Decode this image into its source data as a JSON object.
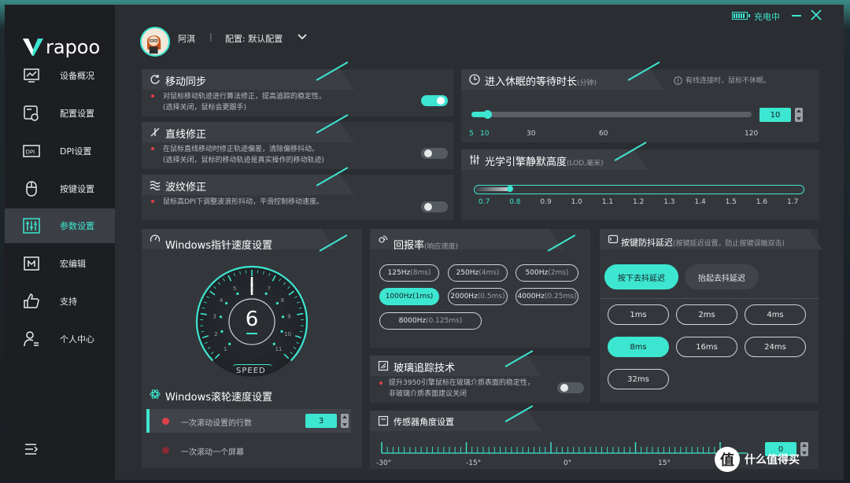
{
  "brand": {
    "logo_text": "rapoo"
  },
  "window": {
    "charging_text": "充电中"
  },
  "header": {
    "user_name": "阿淇",
    "separator": "|",
    "profile_label": "配置: 默认配置"
  },
  "sidebar": {
    "items": [
      {
        "label": "设备概况",
        "icon": "monitor-icon"
      },
      {
        "label": "配置设置",
        "icon": "config-icon"
      },
      {
        "label": "DPI设置",
        "icon": "dpi-icon"
      },
      {
        "label": "按键设置",
        "icon": "mouse-icon"
      },
      {
        "label": "参数设置",
        "icon": "sliders-icon",
        "active": true
      },
      {
        "label": "宏编辑",
        "icon": "macro-icon"
      },
      {
        "label": "支持",
        "icon": "thumbs-up-icon"
      },
      {
        "label": "个人中心",
        "icon": "user-icon"
      }
    ]
  },
  "motion_sync": {
    "title": "移动同步",
    "desc1": "对鼠标移动轨迹进行算法修正，提高追踪的稳定性。",
    "desc2": "(选择关闭，鼠标会更跟手)",
    "enabled": true
  },
  "angle_snap": {
    "title": "直线修正",
    "desc1": "在鼠标直线移动时修正轨迹偏差，清除偏移抖动。",
    "desc2": "(选择关闭，鼠标的移动轨迹是真实操作的移动轨迹)",
    "enabled": false
  },
  "ripple": {
    "title": "波纹修正",
    "desc1": "鼠标高DPI下调整波浪形抖动，平滑控制移动速度。",
    "enabled": false
  },
  "sleep": {
    "title": "进入休眠的等待时长",
    "unit": "(分钟)",
    "note": "有线连接时，鼠标不休眠。",
    "value": "10",
    "min": 5,
    "max": 120,
    "ticks": [
      "5",
      "10",
      "30",
      "60",
      "120"
    ]
  },
  "lod": {
    "title": "光学引擎静默高度",
    "unit": "(LOD,毫米)",
    "value": 0.8,
    "min": 0.7,
    "max": 1.7,
    "ticks": [
      "0.7",
      "0.8",
      "0.9",
      "1.0",
      "1.1",
      "1.2",
      "1.3",
      "1.4",
      "1.5",
      "1.6",
      "1.7"
    ]
  },
  "pointer_speed": {
    "title": "Windows指针速度设置",
    "value": "6",
    "speed_label": "SPEED",
    "dial_numbers": [
      "1",
      "2",
      "3",
      "4",
      "5",
      "6",
      "7",
      "8",
      "9",
      "10",
      "11"
    ]
  },
  "scroll": {
    "title": "Windows滚轮速度设置",
    "row1_label": "一次滚动设置的行数",
    "row1_value": "3",
    "row2_label": "一次滚动一个屏幕"
  },
  "polling": {
    "title": "回报率",
    "unit": "(响应速度)",
    "options": [
      {
        "main": "125Hz",
        "sub": "(8ms)"
      },
      {
        "main": "250Hz",
        "sub": "(4ms)"
      },
      {
        "main": "500Hz",
        "sub": "(2ms)"
      },
      {
        "main": "1000Hz",
        "sub": "(1ms)",
        "selected": true
      },
      {
        "main": "2000Hz",
        "sub": "(0.5ms)"
      },
      {
        "main": "4000Hz",
        "sub": "(0.25ms)"
      },
      {
        "main": "8000Hz",
        "sub": "(0.125ms)"
      }
    ]
  },
  "glass": {
    "title": "玻璃追踪技术",
    "desc1": "提升3950引擎鼠标在玻璃介质表面的稳定性，",
    "desc2": "非玻璃介质表面建议关闭",
    "enabled": false
  },
  "sensor_angle": {
    "title": "传感器角度设置",
    "value": "0",
    "ticks": [
      "-30°",
      "-15°",
      "0°",
      "15°"
    ]
  },
  "debounce": {
    "title": "按键防抖延迟",
    "subtitle": "(按键延迟设置，防止按键误触双击)",
    "tabs": [
      {
        "label": "按下去抖延迟",
        "selected": true
      },
      {
        "label": "抬起去抖延迟"
      }
    ],
    "options": [
      {
        "label": "1ms"
      },
      {
        "label": "2ms"
      },
      {
        "label": "4ms"
      },
      {
        "label": "8ms",
        "selected": true
      },
      {
        "label": "16ms"
      },
      {
        "label": "24ms"
      },
      {
        "label": "32ms"
      }
    ]
  },
  "watermark": {
    "symbol": "值",
    "text": "什么值得买"
  },
  "colors": {
    "accent": "#3de6d0",
    "panel": "#33373c",
    "bg": "#2a2d31",
    "sidebar": "#1c1e22"
  }
}
